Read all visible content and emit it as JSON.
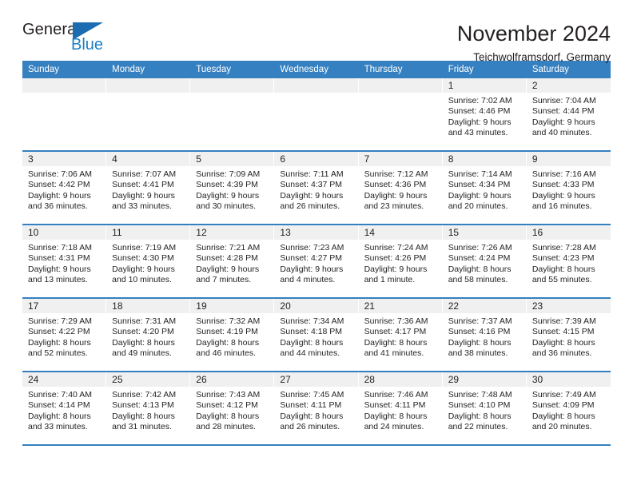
{
  "logo": {
    "word_one": "General",
    "word_two": "Blue",
    "triangle_icon": "triangle-icon",
    "brand_blue": "#1b7fc4",
    "brand_dark": "#231f20"
  },
  "header": {
    "title": "November 2024",
    "subtitle": "Teichwolframsdorf, Germany"
  },
  "calendar": {
    "header_bg": "#3580c0",
    "weekdays": [
      "Sunday",
      "Monday",
      "Tuesday",
      "Wednesday",
      "Thursday",
      "Friday",
      "Saturday"
    ],
    "weeks": [
      [
        {
          "day": "",
          "empty": true
        },
        {
          "day": "",
          "empty": true
        },
        {
          "day": "",
          "empty": true
        },
        {
          "day": "",
          "empty": true
        },
        {
          "day": "",
          "empty": true
        },
        {
          "day": "1",
          "sunrise": "Sunrise: 7:02 AM",
          "sunset": "Sunset: 4:46 PM",
          "daylight": "Daylight: 9 hours and 43 minutes."
        },
        {
          "day": "2",
          "sunrise": "Sunrise: 7:04 AM",
          "sunset": "Sunset: 4:44 PM",
          "daylight": "Daylight: 9 hours and 40 minutes."
        }
      ],
      [
        {
          "day": "3",
          "sunrise": "Sunrise: 7:06 AM",
          "sunset": "Sunset: 4:42 PM",
          "daylight": "Daylight: 9 hours and 36 minutes."
        },
        {
          "day": "4",
          "sunrise": "Sunrise: 7:07 AM",
          "sunset": "Sunset: 4:41 PM",
          "daylight": "Daylight: 9 hours and 33 minutes."
        },
        {
          "day": "5",
          "sunrise": "Sunrise: 7:09 AM",
          "sunset": "Sunset: 4:39 PM",
          "daylight": "Daylight: 9 hours and 30 minutes."
        },
        {
          "day": "6",
          "sunrise": "Sunrise: 7:11 AM",
          "sunset": "Sunset: 4:37 PM",
          "daylight": "Daylight: 9 hours and 26 minutes."
        },
        {
          "day": "7",
          "sunrise": "Sunrise: 7:12 AM",
          "sunset": "Sunset: 4:36 PM",
          "daylight": "Daylight: 9 hours and 23 minutes."
        },
        {
          "day": "8",
          "sunrise": "Sunrise: 7:14 AM",
          "sunset": "Sunset: 4:34 PM",
          "daylight": "Daylight: 9 hours and 20 minutes."
        },
        {
          "day": "9",
          "sunrise": "Sunrise: 7:16 AM",
          "sunset": "Sunset: 4:33 PM",
          "daylight": "Daylight: 9 hours and 16 minutes."
        }
      ],
      [
        {
          "day": "10",
          "sunrise": "Sunrise: 7:18 AM",
          "sunset": "Sunset: 4:31 PM",
          "daylight": "Daylight: 9 hours and 13 minutes."
        },
        {
          "day": "11",
          "sunrise": "Sunrise: 7:19 AM",
          "sunset": "Sunset: 4:30 PM",
          "daylight": "Daylight: 9 hours and 10 minutes."
        },
        {
          "day": "12",
          "sunrise": "Sunrise: 7:21 AM",
          "sunset": "Sunset: 4:28 PM",
          "daylight": "Daylight: 9 hours and 7 minutes."
        },
        {
          "day": "13",
          "sunrise": "Sunrise: 7:23 AM",
          "sunset": "Sunset: 4:27 PM",
          "daylight": "Daylight: 9 hours and 4 minutes."
        },
        {
          "day": "14",
          "sunrise": "Sunrise: 7:24 AM",
          "sunset": "Sunset: 4:26 PM",
          "daylight": "Daylight: 9 hours and 1 minute."
        },
        {
          "day": "15",
          "sunrise": "Sunrise: 7:26 AM",
          "sunset": "Sunset: 4:24 PM",
          "daylight": "Daylight: 8 hours and 58 minutes."
        },
        {
          "day": "16",
          "sunrise": "Sunrise: 7:28 AM",
          "sunset": "Sunset: 4:23 PM",
          "daylight": "Daylight: 8 hours and 55 minutes."
        }
      ],
      [
        {
          "day": "17",
          "sunrise": "Sunrise: 7:29 AM",
          "sunset": "Sunset: 4:22 PM",
          "daylight": "Daylight: 8 hours and 52 minutes."
        },
        {
          "day": "18",
          "sunrise": "Sunrise: 7:31 AM",
          "sunset": "Sunset: 4:20 PM",
          "daylight": "Daylight: 8 hours and 49 minutes."
        },
        {
          "day": "19",
          "sunrise": "Sunrise: 7:32 AM",
          "sunset": "Sunset: 4:19 PM",
          "daylight": "Daylight: 8 hours and 46 minutes."
        },
        {
          "day": "20",
          "sunrise": "Sunrise: 7:34 AM",
          "sunset": "Sunset: 4:18 PM",
          "daylight": "Daylight: 8 hours and 44 minutes."
        },
        {
          "day": "21",
          "sunrise": "Sunrise: 7:36 AM",
          "sunset": "Sunset: 4:17 PM",
          "daylight": "Daylight: 8 hours and 41 minutes."
        },
        {
          "day": "22",
          "sunrise": "Sunrise: 7:37 AM",
          "sunset": "Sunset: 4:16 PM",
          "daylight": "Daylight: 8 hours and 38 minutes."
        },
        {
          "day": "23",
          "sunrise": "Sunrise: 7:39 AM",
          "sunset": "Sunset: 4:15 PM",
          "daylight": "Daylight: 8 hours and 36 minutes."
        }
      ],
      [
        {
          "day": "24",
          "sunrise": "Sunrise: 7:40 AM",
          "sunset": "Sunset: 4:14 PM",
          "daylight": "Daylight: 8 hours and 33 minutes."
        },
        {
          "day": "25",
          "sunrise": "Sunrise: 7:42 AM",
          "sunset": "Sunset: 4:13 PM",
          "daylight": "Daylight: 8 hours and 31 minutes."
        },
        {
          "day": "26",
          "sunrise": "Sunrise: 7:43 AM",
          "sunset": "Sunset: 4:12 PM",
          "daylight": "Daylight: 8 hours and 28 minutes."
        },
        {
          "day": "27",
          "sunrise": "Sunrise: 7:45 AM",
          "sunset": "Sunset: 4:11 PM",
          "daylight": "Daylight: 8 hours and 26 minutes."
        },
        {
          "day": "28",
          "sunrise": "Sunrise: 7:46 AM",
          "sunset": "Sunset: 4:11 PM",
          "daylight": "Daylight: 8 hours and 24 minutes."
        },
        {
          "day": "29",
          "sunrise": "Sunrise: 7:48 AM",
          "sunset": "Sunset: 4:10 PM",
          "daylight": "Daylight: 8 hours and 22 minutes."
        },
        {
          "day": "30",
          "sunrise": "Sunrise: 7:49 AM",
          "sunset": "Sunset: 4:09 PM",
          "daylight": "Daylight: 8 hours and 20 minutes."
        }
      ]
    ]
  }
}
